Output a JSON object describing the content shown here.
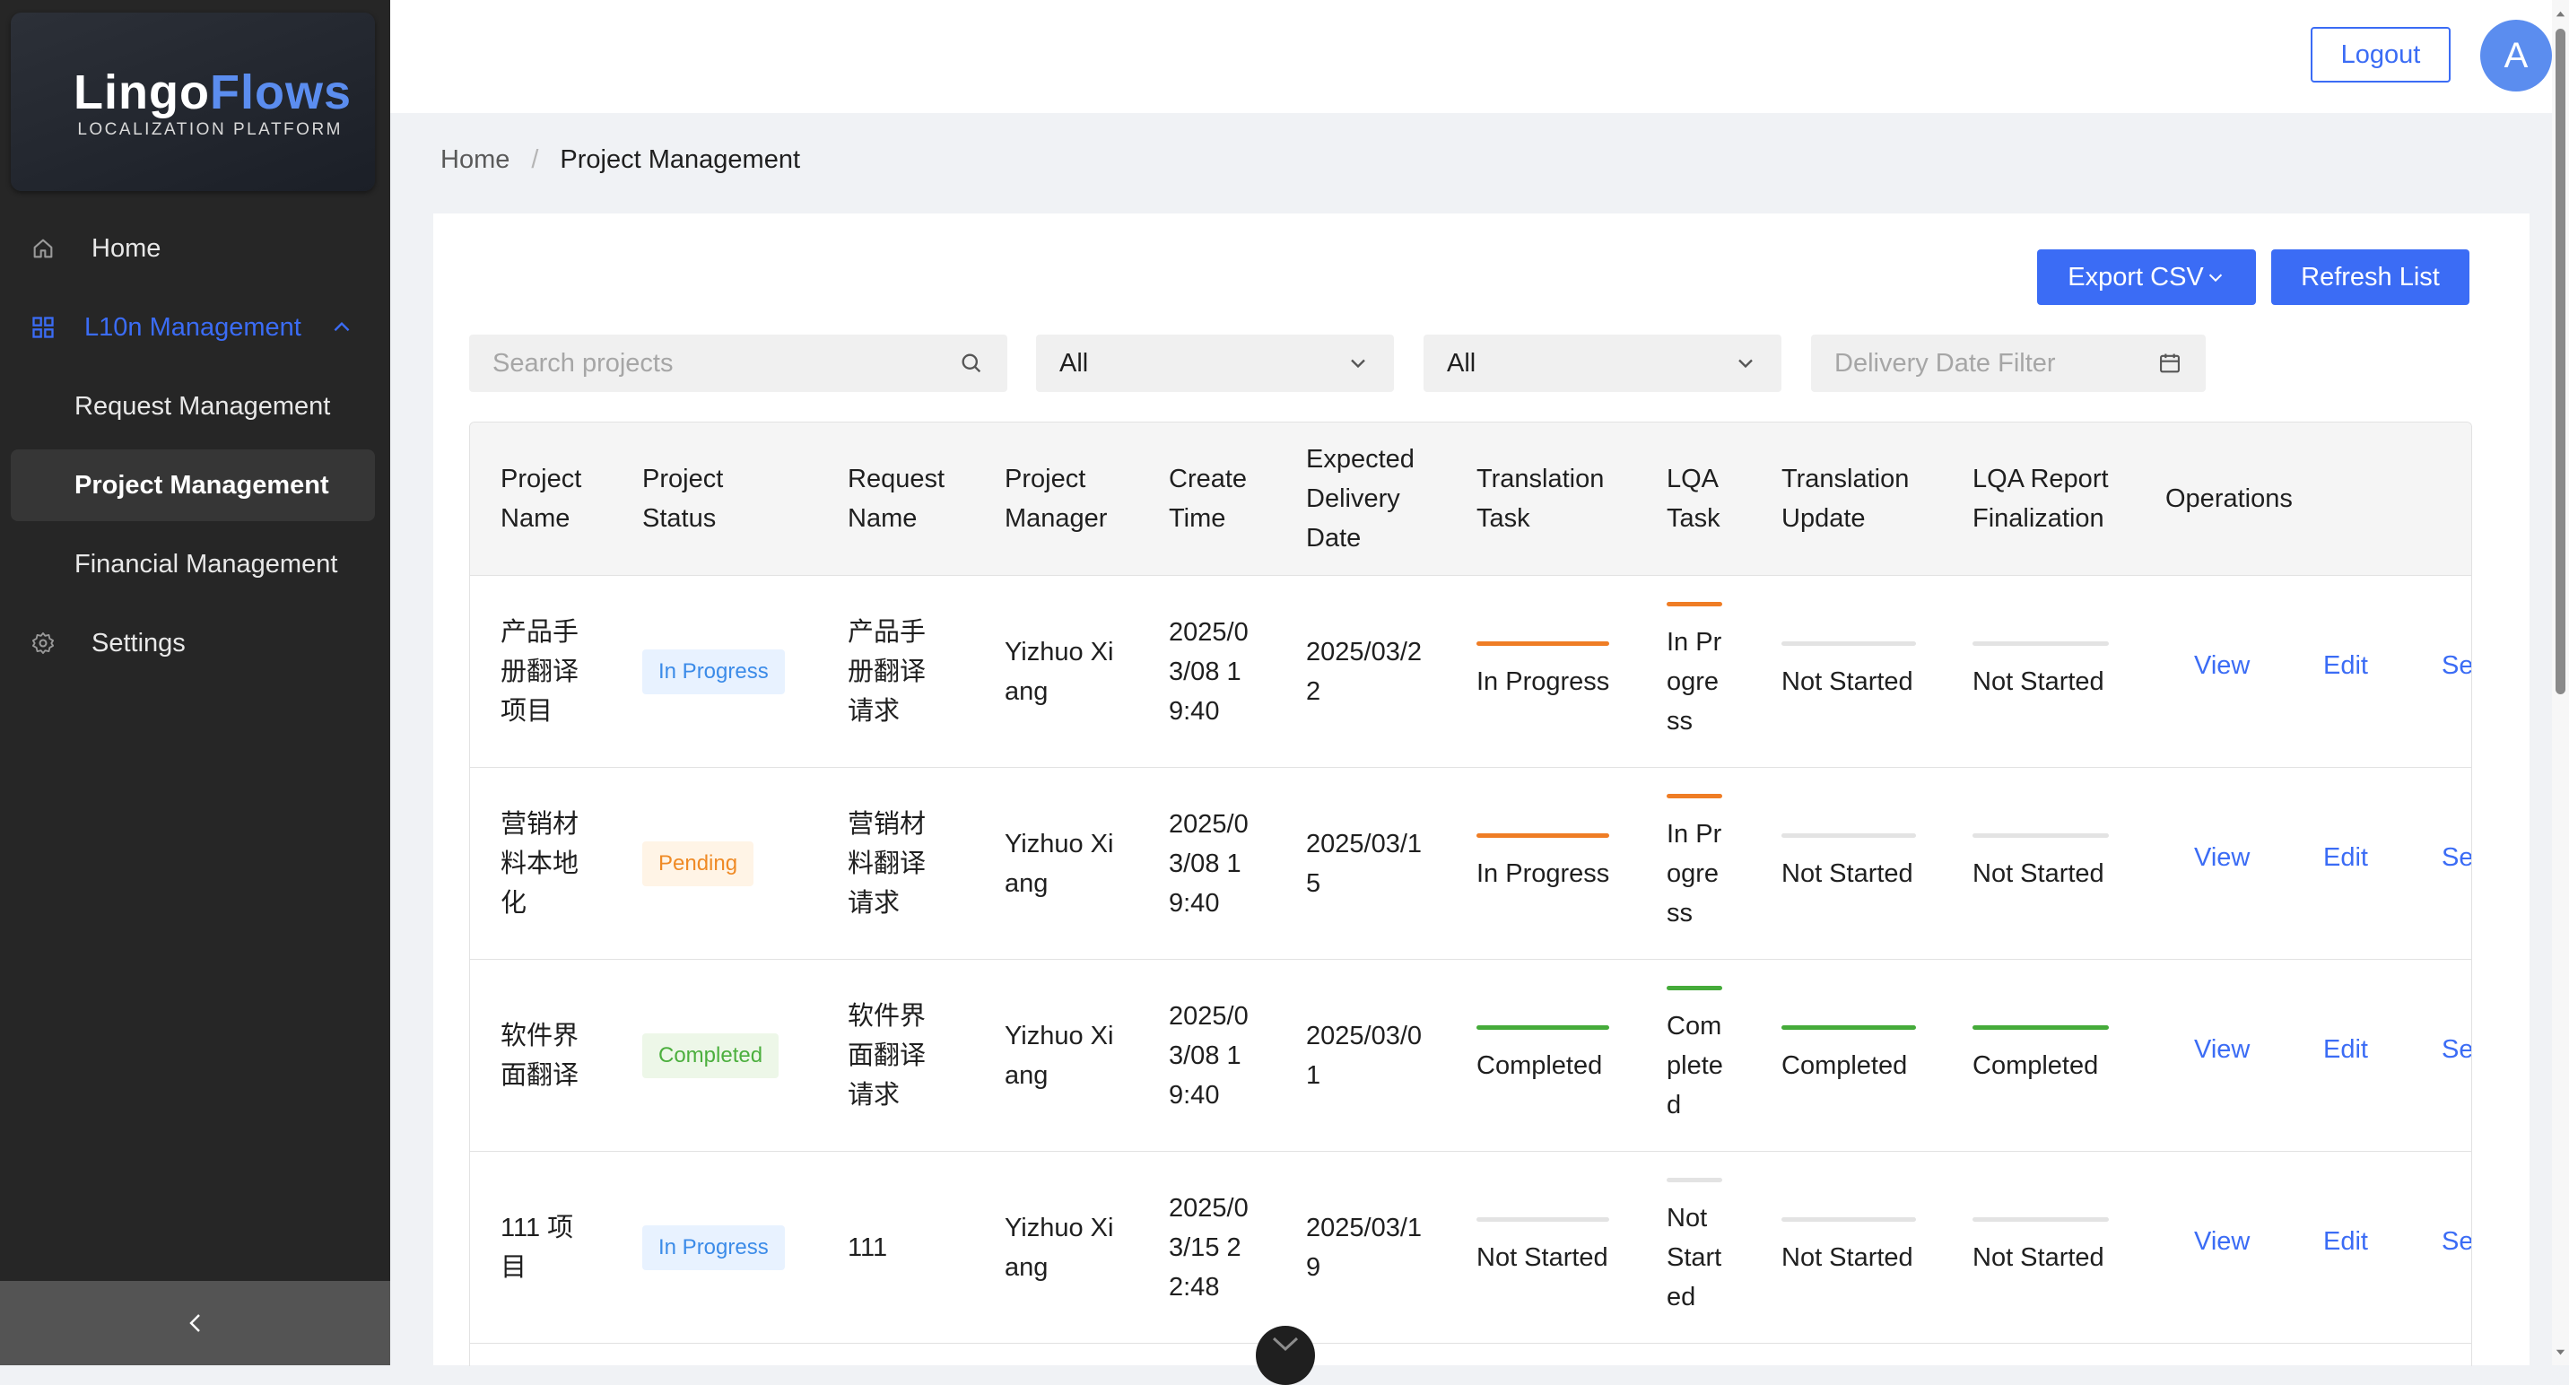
{
  "brand": {
    "name_part1": "Lingo",
    "name_part2": "Flows",
    "tagline": "LOCALIZATION PLATFORM"
  },
  "sidebar": {
    "items": [
      {
        "label": "Home",
        "icon": "home-icon"
      },
      {
        "label": "L10n Management",
        "icon": "grid-icon",
        "expanded": true
      },
      {
        "label": "Request Management"
      },
      {
        "label": "Project Management",
        "selected": true
      },
      {
        "label": "Financial Management"
      },
      {
        "label": "Settings",
        "icon": "gear-icon"
      }
    ],
    "collapse_icon": "chevron-left-icon"
  },
  "header": {
    "logout_label": "Logout",
    "avatar_initial": "A"
  },
  "breadcrumb": {
    "home": "Home",
    "separator": "/",
    "current": "Project Management"
  },
  "toolbar": {
    "export_label": "Export CSV",
    "refresh_label": "Refresh List"
  },
  "filters": {
    "search_placeholder": "Search projects",
    "status_value": "All",
    "manager_value": "All",
    "date_placeholder": "Delivery Date Filter"
  },
  "table": {
    "columns": [
      "Project Name",
      "Project Status",
      "Request Name",
      "Project Manager",
      "Create Time",
      "Expected Delivery Date",
      "Translation Task",
      "LQA Task",
      "Translation Update",
      "LQA Report Finalization",
      "Operations"
    ],
    "rows": [
      {
        "project_name": "产品手册翻译项目",
        "status": "In Progress",
        "request_name": "产品手册翻译请求",
        "manager": "Yizhuo Xiang",
        "create_time": "2025/03/08 19:40",
        "delivery_date": "2025/03/22",
        "translation_task": "In Progress",
        "lqa_task": "In Progress",
        "translation_update": "Not Started",
        "lqa_report": "Not Started"
      },
      {
        "project_name": "营销材料本地化",
        "status": "Pending",
        "request_name": "营销材料翻译请求",
        "manager": "Yizhuo Xiang",
        "create_time": "2025/03/08 19:40",
        "delivery_date": "2025/03/15",
        "translation_task": "In Progress",
        "lqa_task": "In Progress",
        "translation_update": "Not Started",
        "lqa_report": "Not Started"
      },
      {
        "project_name": "软件界面翻译",
        "status": "Completed",
        "request_name": "软件界面翻译请求",
        "manager": "Yizhuo Xiang",
        "create_time": "2025/03/08 19:40",
        "delivery_date": "2025/03/01",
        "translation_task": "Completed",
        "lqa_task": "Completed",
        "translation_update": "Completed",
        "lqa_report": "Completed"
      },
      {
        "project_name": "111 项目",
        "status": "In Progress",
        "request_name": "111",
        "manager": "Yizhuo Xiang",
        "create_time": "2025/03/15 22:48",
        "delivery_date": "2025/03/19",
        "translation_task": "Not Started",
        "lqa_task": "Not Started",
        "translation_update": "Not Started",
        "lqa_report": "Not Started"
      }
    ],
    "operations": {
      "view": "View",
      "edit": "Edit",
      "third_truncated": "Se"
    }
  },
  "colors": {
    "accent": "#3b6cf5",
    "sidebar_bg": "#262626",
    "in_progress_bar": "#ef7d25",
    "completed_bar": "#45ab3a",
    "not_started_bar": "#e3e3e3"
  }
}
